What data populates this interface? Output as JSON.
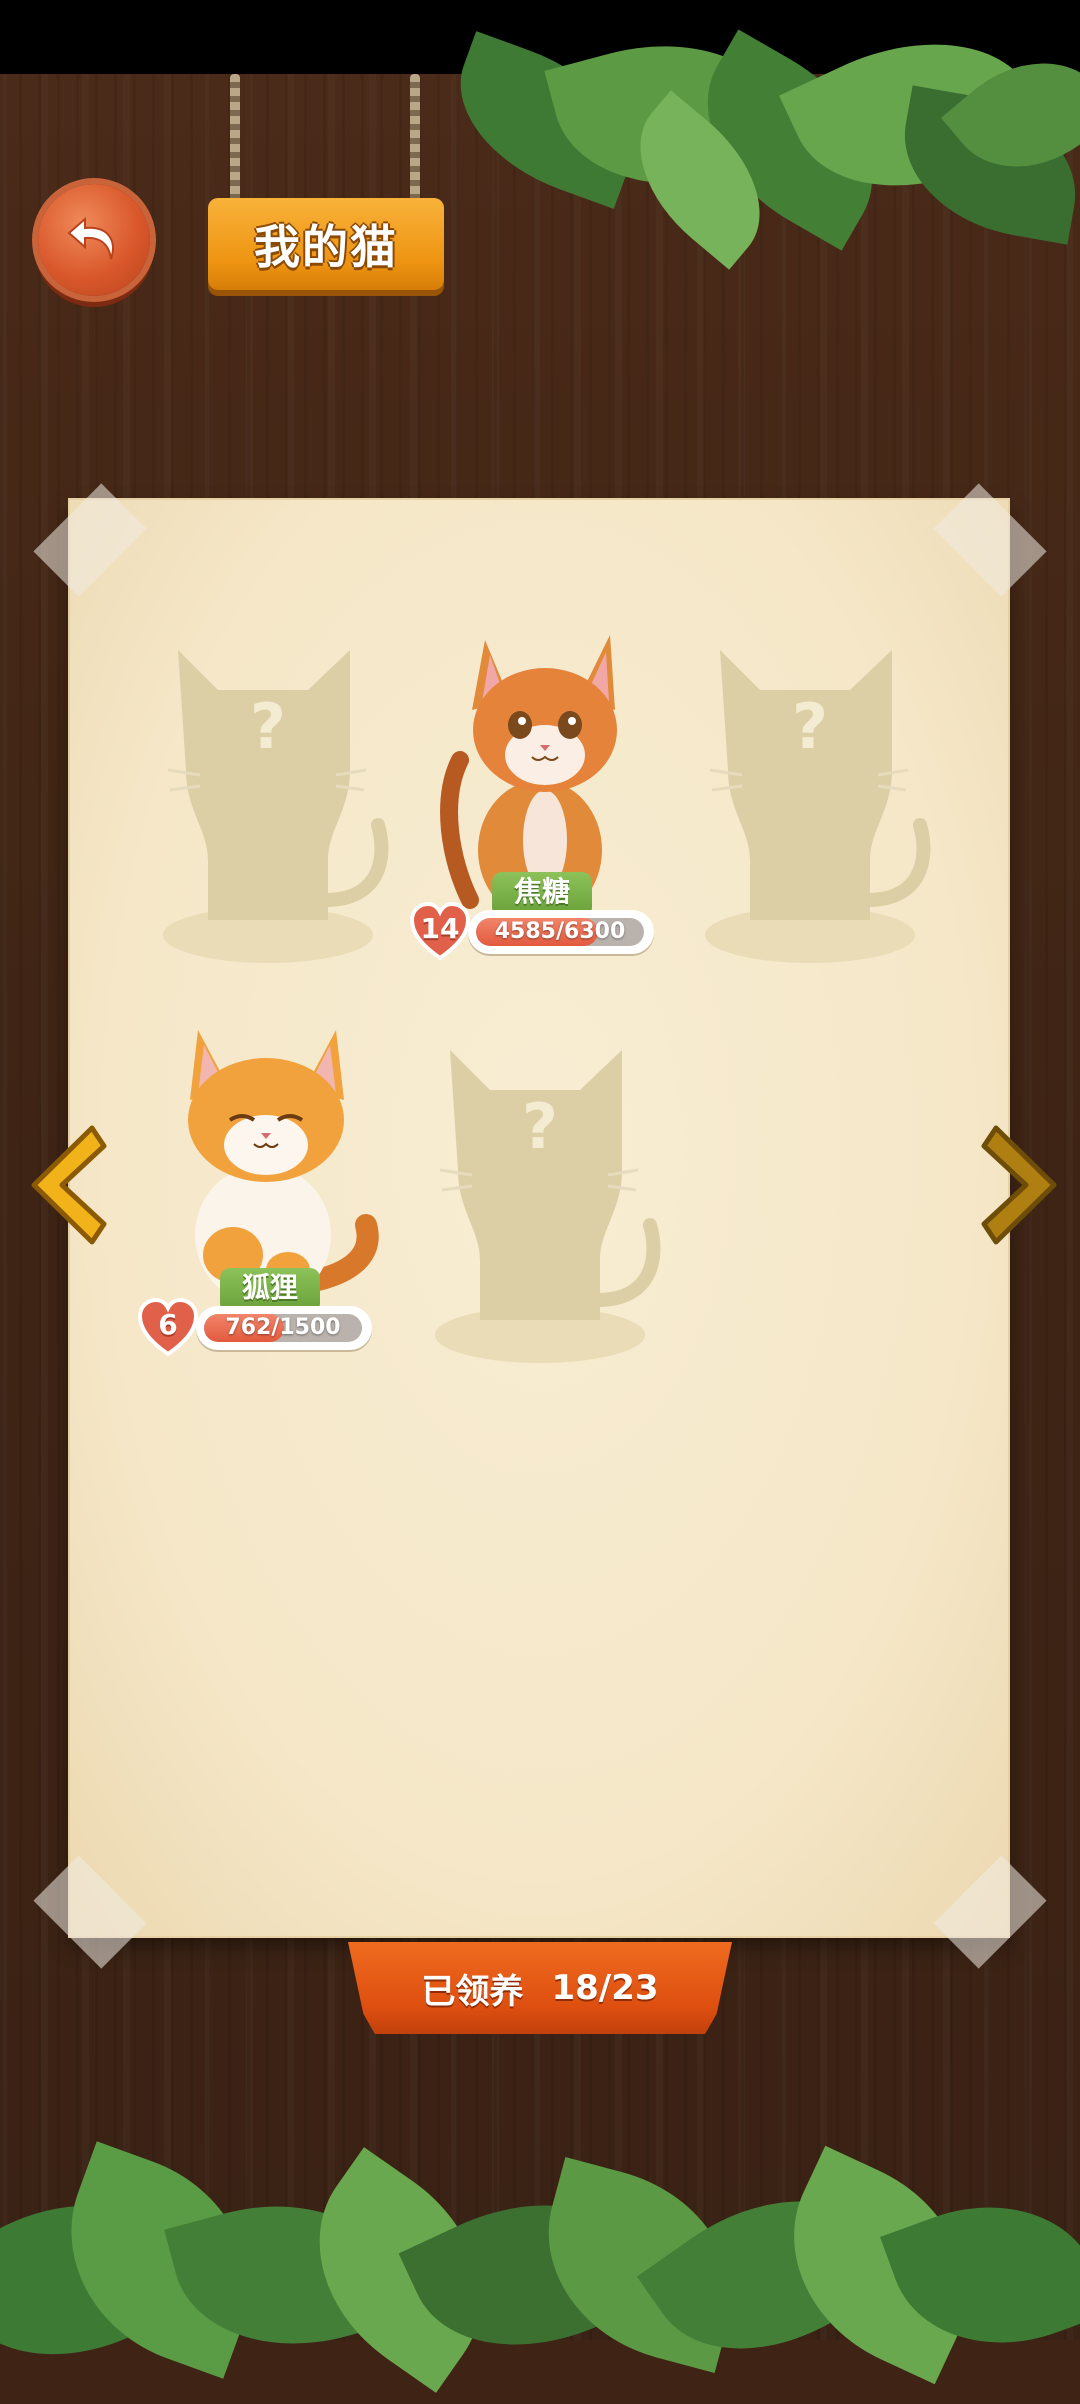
{
  "header": {
    "back_icon": "undo-arrow-icon",
    "title": "我的猫"
  },
  "cats": [
    {
      "slot": 1,
      "unlocked": false,
      "placeholder": "?"
    },
    {
      "slot": 2,
      "unlocked": true,
      "name": "焦糖",
      "level": "14",
      "xp_text": "4585/6300",
      "xp_fraction": 0.728,
      "fur": "orange"
    },
    {
      "slot": 3,
      "unlocked": false,
      "placeholder": "?"
    },
    {
      "slot": 4,
      "unlocked": true,
      "name": "狐狸",
      "level": "6",
      "xp_text": "762/1500",
      "xp_fraction": 0.508,
      "fur": "calico"
    },
    {
      "slot": 5,
      "unlocked": false,
      "placeholder": "?"
    }
  ],
  "navigation": {
    "prev_icon": "chevron-left-icon",
    "next_icon": "chevron-right-icon"
  },
  "footer": {
    "claimed_label": "已领养",
    "claimed_count": "18/23"
  },
  "colors": {
    "wood": "#3f2416",
    "paper": "#f5e7c8",
    "accent_orange": "#e25a3e",
    "title_plank": "#ee9412",
    "name_tag_green": "#7ab049",
    "silhouette": "#dccfa6"
  }
}
